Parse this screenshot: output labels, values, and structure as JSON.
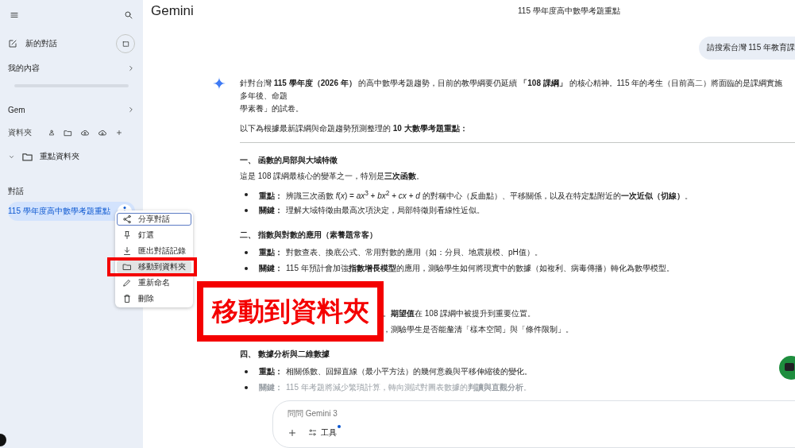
{
  "sidebar": {
    "new_chat": "新的對話",
    "my_content": "我的內容",
    "gem": "Gem",
    "folders_label": "資料夾",
    "folders": [
      {
        "name": "重點資料夾",
        "expanded": false
      }
    ],
    "chats_label": "對話",
    "chats": [
      {
        "title": "115 學年度高中數學考題重點",
        "selected": true
      }
    ]
  },
  "context_menu": {
    "items": [
      {
        "label": "分享對話",
        "focused": true,
        "highlighted": false
      },
      {
        "label": "釘選",
        "focused": false,
        "highlighted": false
      },
      {
        "label": "匯出對話記錄",
        "focused": false,
        "highlighted": false
      },
      {
        "label": "移動到資料夾",
        "focused": false,
        "highlighted": true
      },
      {
        "label": "重新命名",
        "focused": false,
        "highlighted": false
      },
      {
        "label": "刪除",
        "focused": false,
        "highlighted": false
      }
    ]
  },
  "annotation": {
    "text": "移動到資料夾"
  },
  "top_bar": {
    "brand": "Gemini",
    "title": "115 學年度高中數學考題重點"
  },
  "user_message": "請搜索台灣 115 年教育課",
  "response": {
    "intro_lines": [
      "針對台灣 **115 學年度（2026 年）** 的高中數學考題趨勢，目前的教學綱要仍延續 **「108 課綱」** 的核心精神。115 年的考生（目前高二）將面臨的是課綱實施多年後、命題",
      "學素養」的試卷。"
    ],
    "lead": "以下為根據最新課綱與命題趨勢預測整理的 **10 大數學考題重點：**",
    "sections": [
      {
        "heading": "一、 函數的局部與大域特徵",
        "intro": "這是 108 課綱最核心的變革之一，特別是**三次函數**。",
        "bullets": [
          {
            "kind": "full",
            "label": "重點：",
            "text": "辨識三次函數 *f*(*x*) = *ax*$^{3}$ + *bx*$^{2}$ + *cx* + *d* 的對稱中心（反曲點）、平移關係，以及在特定點附近的**一次近似（切線）**。",
            "faded": false
          },
          {
            "kind": "full",
            "label": "關鍵：",
            "text": "理解大域特徵由最高次項決定，局部特徵則看線性近似。",
            "faded": false
          }
        ]
      },
      {
        "heading": "二、 指數與對數的應用（素養題常客）",
        "bullets": [
          {
            "kind": "full",
            "label": "重點：",
            "text": "對數查表、換底公式、常用對數的應用（如：分貝、地震規模、pH值）。",
            "faded": false
          },
          {
            "kind": "full",
            "label": "關鍵：",
            "text": "115 年預計會加強**指數增長模型**的應用，測驗學生如何將現實中的數據（如複利、病毒傳播）轉化為數學模型。",
            "faded": false
          }
        ]
      },
      {
        "bullets": [
          {
            "kind": "covered",
            "text": "。**期望值**在 108 課綱中被提升到重要位置。",
            "faded": false
          },
          {
            "kind": "covered",
            "text": "，測驗學生是否能釐清「樣本空間」與「條件限制」。",
            "faded": false
          }
        ]
      },
      {
        "heading": "四、 數據分析與二維數據",
        "bullets": [
          {
            "kind": "full",
            "label": "重點：",
            "text": "相關係數、回歸直線（最小平方法）的幾何意義與平移伸縮後的變化。",
            "faded": false
          },
          {
            "kind": "full",
            "label": "關鍵：",
            "text": "115 年考題將減少繁瑣計算，轉向測試對圖表數據的**判讀與直觀分析**。",
            "faded": true
          }
        ]
      }
    ]
  },
  "composer": {
    "placeholder": "問問 Gemini 3",
    "tools_label": "工具",
    "tools_badge": true
  }
}
